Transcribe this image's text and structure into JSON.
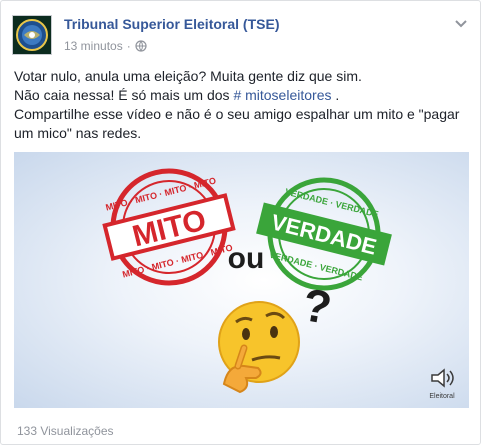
{
  "post": {
    "page_name": "Tribunal Superior Eleitoral (TSE)",
    "timestamp": "13 minutos",
    "separator": "·",
    "privacy_icon": "globe-icon",
    "menu_icon": "chevron-down-icon",
    "text": {
      "line1": "Votar nulo, anula uma eleição? Muita gente diz que sim.",
      "line2_prefix": "Não caia nessa! É só mais um dos ",
      "hashtag": "# mitoseleitores",
      "line2_suffix": " .",
      "line3": "Compartilhe esse vídeo e não é o seu amigo espalhar um mito e \"pagar um mico\" nas redes."
    },
    "media": {
      "stamp_red_word": "MITO",
      "stamp_red_ring": "MITO · MITO · MITO · MITO",
      "connector": "ou",
      "stamp_green_word": "VERDADE",
      "stamp_green_ring": "VERDADE · VERDADE",
      "question_mark": "?",
      "emoji": "thinking-face",
      "watermark_label": "Eleitoral"
    },
    "views": "133 Visualizações"
  },
  "colors": {
    "link": "#365899",
    "meta": "#90949c",
    "stamp_red": "#d5262c",
    "stamp_green": "#3aa53a"
  }
}
